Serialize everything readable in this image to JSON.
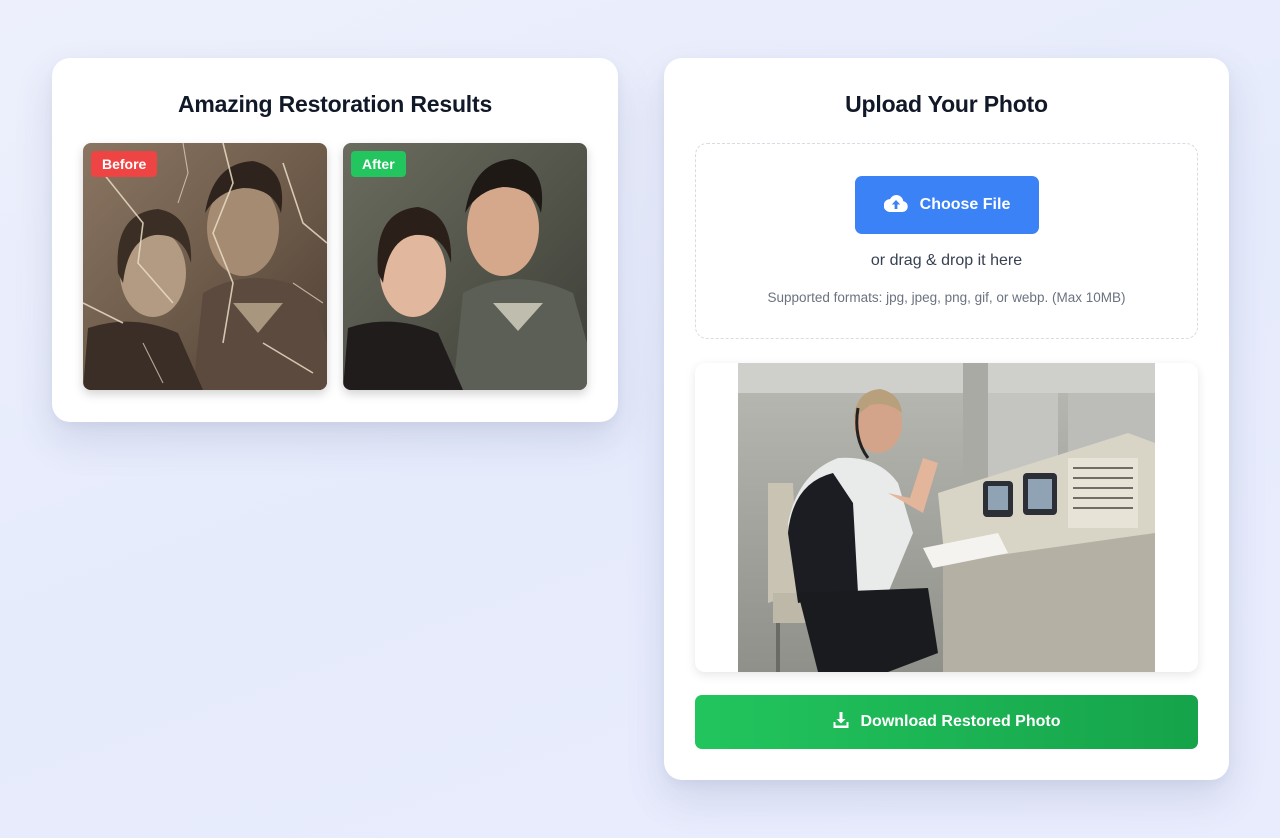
{
  "results_card": {
    "title": "Amazing Restoration Results",
    "before_badge": "Before",
    "after_badge": "After",
    "colors": {
      "before_badge": "#ef4444",
      "after_badge": "#22c55e"
    }
  },
  "upload_card": {
    "title": "Upload Your Photo",
    "choose_button": {
      "label": "Choose File",
      "icon": "cloud-upload-icon",
      "color": "#3b82f6"
    },
    "drag_text": "or drag & drop it here",
    "formats_text": "Supported formats: jpg, jpeg, png, gif, or webp. (Max 10MB)",
    "download_button": {
      "label": "Download Restored Photo",
      "icon": "download-icon",
      "color": "#22c55e"
    }
  }
}
